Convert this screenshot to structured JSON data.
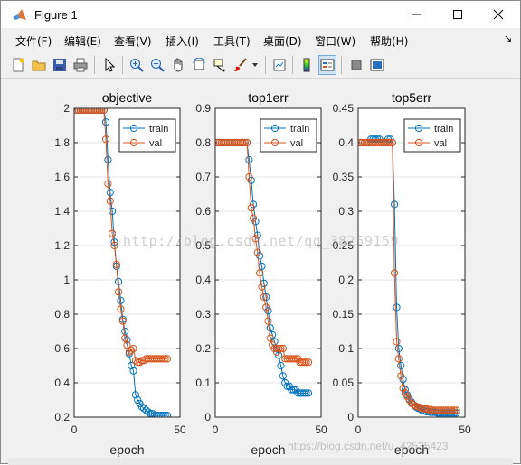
{
  "window": {
    "title": "Figure 1",
    "minimize_glyph": "—",
    "maximize_glyph": "☐",
    "close_glyph": "✕"
  },
  "menus": [
    {
      "label": "文件(F)"
    },
    {
      "label": "编辑(E)"
    },
    {
      "label": "查看(V)"
    },
    {
      "label": "插入(I)"
    },
    {
      "label": "工具(T)"
    },
    {
      "label": "桌面(D)"
    },
    {
      "label": "窗口(W)"
    },
    {
      "label": "帮助(H)"
    }
  ],
  "menu_dock_arrow": "↘",
  "toolbar": {
    "icons": [
      "new-figure-icon",
      "open-file-icon",
      "save-icon",
      "print-icon",
      "edit-plot-arrow-icon",
      "zoom-in-icon",
      "zoom-out-icon",
      "pan-hand-icon",
      "rotate-3d-icon",
      "data-cursor-icon",
      "brush-icon",
      "link-plot-icon",
      "insert-colorbar-icon",
      "insert-legend-icon",
      "hide-plot-tools-icon",
      "show-plot-tools-icon"
    ]
  },
  "colors": {
    "train": "#0072bd",
    "val": "#d95319",
    "axes_bg": "#ffffff",
    "grid": "#e6e6e6"
  },
  "watermark": "http://blog.csdn.net/qq_38259159",
  "watermark2": "https://blog.csdn.net/u_42535423",
  "chart_data": [
    {
      "type": "line",
      "title": "objective",
      "xlabel": "epoch",
      "ylabel": "",
      "xlim": [
        0,
        50
      ],
      "ylim": [
        0.2,
        2
      ],
      "xticks": [
        0,
        50
      ],
      "yticks": [
        0.2,
        0.4,
        0.6,
        0.8,
        1,
        1.2,
        1.4,
        1.6,
        1.8,
        2
      ],
      "ytick_labels": [
        "0.2",
        "0.4",
        "0.6",
        "0.8",
        "1",
        "1.2",
        "1.4",
        "1.6",
        "1.8",
        "2"
      ],
      "grid": "y",
      "legend": "top-right",
      "series": [
        {
          "name": "train",
          "x": [
            1,
            2,
            3,
            4,
            5,
            6,
            7,
            8,
            9,
            10,
            11,
            12,
            13,
            14,
            15,
            16,
            17,
            18,
            19,
            20,
            21,
            22,
            23,
            24,
            25,
            26,
            27,
            28,
            29,
            30,
            31,
            32,
            33,
            34,
            35,
            36,
            37,
            38,
            39,
            40,
            41,
            42,
            43,
            44
          ],
          "y": [
            1.99,
            1.99,
            1.99,
            1.99,
            1.99,
            1.99,
            1.99,
            1.99,
            1.99,
            1.99,
            1.99,
            1.99,
            1.99,
            1.99,
            1.92,
            1.7,
            1.51,
            1.4,
            1.22,
            1.08,
            0.99,
            0.88,
            0.77,
            0.7,
            0.65,
            0.57,
            0.5,
            0.47,
            0.33,
            0.3,
            0.28,
            0.26,
            0.25,
            0.24,
            0.23,
            0.22,
            0.22,
            0.21,
            0.21,
            0.21,
            0.21,
            0.21,
            0.21,
            0.21
          ]
        },
        {
          "name": "val",
          "x": [
            1,
            2,
            3,
            4,
            5,
            6,
            7,
            8,
            9,
            10,
            11,
            12,
            13,
            14,
            15,
            16,
            17,
            18,
            19,
            20,
            21,
            22,
            23,
            24,
            25,
            26,
            27,
            28,
            29,
            30,
            31,
            32,
            33,
            34,
            35,
            36,
            37,
            38,
            39,
            40,
            41,
            42,
            43,
            44
          ],
          "y": [
            1.99,
            1.99,
            1.99,
            1.99,
            1.99,
            1.99,
            1.99,
            1.99,
            1.99,
            1.99,
            1.99,
            1.99,
            1.99,
            1.99,
            1.82,
            1.56,
            1.46,
            1.27,
            1.2,
            1.09,
            0.93,
            0.83,
            0.76,
            0.66,
            0.62,
            0.58,
            0.59,
            0.6,
            0.53,
            0.52,
            0.52,
            0.53,
            0.53,
            0.54,
            0.54,
            0.54,
            0.54,
            0.54,
            0.54,
            0.54,
            0.54,
            0.54,
            0.54,
            0.54
          ]
        }
      ]
    },
    {
      "type": "line",
      "title": "top1err",
      "xlabel": "epoch",
      "ylabel": "",
      "xlim": [
        0,
        50
      ],
      "ylim": [
        0,
        0.9
      ],
      "xticks": [
        0,
        50
      ],
      "yticks": [
        0,
        0.1,
        0.2,
        0.3,
        0.4,
        0.5,
        0.6,
        0.7,
        0.8,
        0.9
      ],
      "ytick_labels": [
        "0",
        "0.1",
        "0.2",
        "0.3",
        "0.4",
        "0.5",
        "0.6",
        "0.7",
        "0.8",
        "0.9"
      ],
      "grid": "y",
      "legend": "top-right",
      "series": [
        {
          "name": "train",
          "x": [
            1,
            2,
            3,
            4,
            5,
            6,
            7,
            8,
            9,
            10,
            11,
            12,
            13,
            14,
            15,
            16,
            17,
            18,
            19,
            20,
            21,
            22,
            23,
            24,
            25,
            26,
            27,
            28,
            29,
            30,
            31,
            32,
            33,
            34,
            35,
            36,
            37,
            38,
            39,
            40,
            41,
            42,
            43,
            44
          ],
          "y": [
            0.8,
            0.8,
            0.8,
            0.8,
            0.8,
            0.8,
            0.8,
            0.8,
            0.8,
            0.8,
            0.8,
            0.8,
            0.8,
            0.8,
            0.8,
            0.75,
            0.69,
            0.62,
            0.57,
            0.53,
            0.47,
            0.44,
            0.39,
            0.35,
            0.31,
            0.26,
            0.24,
            0.22,
            0.2,
            0.18,
            0.15,
            0.12,
            0.1,
            0.09,
            0.09,
            0.08,
            0.08,
            0.08,
            0.07,
            0.07,
            0.07,
            0.07,
            0.07,
            0.07
          ]
        },
        {
          "name": "val",
          "x": [
            1,
            2,
            3,
            4,
            5,
            6,
            7,
            8,
            9,
            10,
            11,
            12,
            13,
            14,
            15,
            16,
            17,
            18,
            19,
            20,
            21,
            22,
            23,
            24,
            25,
            26,
            27,
            28,
            29,
            30,
            31,
            32,
            33,
            34,
            35,
            36,
            37,
            38,
            39,
            40,
            41,
            42,
            43,
            44
          ],
          "y": [
            0.8,
            0.8,
            0.8,
            0.8,
            0.8,
            0.8,
            0.8,
            0.8,
            0.8,
            0.8,
            0.8,
            0.8,
            0.8,
            0.8,
            0.8,
            0.7,
            0.61,
            0.58,
            0.52,
            0.48,
            0.42,
            0.38,
            0.35,
            0.32,
            0.28,
            0.23,
            0.21,
            0.2,
            0.19,
            0.2,
            0.2,
            0.2,
            0.17,
            0.17,
            0.17,
            0.17,
            0.17,
            0.17,
            0.17,
            0.16,
            0.16,
            0.16,
            0.16,
            0.16
          ]
        }
      ]
    },
    {
      "type": "line",
      "title": "top5err",
      "xlabel": "epoch",
      "ylabel": "",
      "xlim": [
        0,
        50
      ],
      "ylim": [
        0,
        0.45
      ],
      "xticks": [
        0,
        50
      ],
      "yticks": [
        0,
        0.05,
        0.1,
        0.15,
        0.2,
        0.25,
        0.3,
        0.35,
        0.4,
        0.45
      ],
      "ytick_labels": [
        "0",
        "0.05",
        "0.1",
        "0.15",
        "0.2",
        "0.25",
        "0.3",
        "0.35",
        "0.4",
        "0.45"
      ],
      "grid": "y",
      "legend": "top-right",
      "series": [
        {
          "name": "train",
          "x": [
            1,
            2,
            3,
            4,
            5,
            6,
            7,
            8,
            9,
            10,
            11,
            12,
            13,
            14,
            15,
            16,
            17,
            18,
            19,
            20,
            21,
            22,
            23,
            24,
            25,
            26,
            27,
            28,
            29,
            30,
            31,
            32,
            33,
            34,
            35,
            36,
            37,
            38,
            39,
            40,
            41,
            42,
            43,
            44,
            45,
            46
          ],
          "y": [
            0.4,
            0.4,
            0.4,
            0.4,
            0.4,
            0.405,
            0.405,
            0.405,
            0.405,
            0.405,
            0.4,
            0.4,
            0.4,
            0.405,
            0.405,
            0.4,
            0.31,
            0.16,
            0.1,
            0.075,
            0.055,
            0.04,
            0.032,
            0.026,
            0.022,
            0.018,
            0.015,
            0.013,
            0.012,
            0.01,
            0.009,
            0.008,
            0.008,
            0.007,
            0.007,
            0.007,
            0.006,
            0.006,
            0.006,
            0.006,
            0.006,
            0.006,
            0.006,
            0.006,
            0.006,
            0.006
          ]
        },
        {
          "name": "val",
          "x": [
            1,
            2,
            3,
            4,
            5,
            6,
            7,
            8,
            9,
            10,
            11,
            12,
            13,
            14,
            15,
            16,
            17,
            18,
            19,
            20,
            21,
            22,
            23,
            24,
            25,
            26,
            27,
            28,
            29,
            30,
            31,
            32,
            33,
            34,
            35,
            36,
            37,
            38,
            39,
            40,
            41,
            42,
            43,
            44,
            45,
            46
          ],
          "y": [
            0.4,
            0.4,
            0.4,
            0.4,
            0.4,
            0.4,
            0.4,
            0.4,
            0.4,
            0.4,
            0.4,
            0.4,
            0.4,
            0.4,
            0.4,
            0.4,
            0.21,
            0.11,
            0.085,
            0.06,
            0.042,
            0.035,
            0.03,
            0.025,
            0.02,
            0.018,
            0.016,
            0.015,
            0.014,
            0.013,
            0.012,
            0.012,
            0.011,
            0.011,
            0.01,
            0.01,
            0.01,
            0.01,
            0.01,
            0.01,
            0.01,
            0.01,
            0.01,
            0.01,
            0.01,
            0.01
          ]
        }
      ]
    }
  ]
}
